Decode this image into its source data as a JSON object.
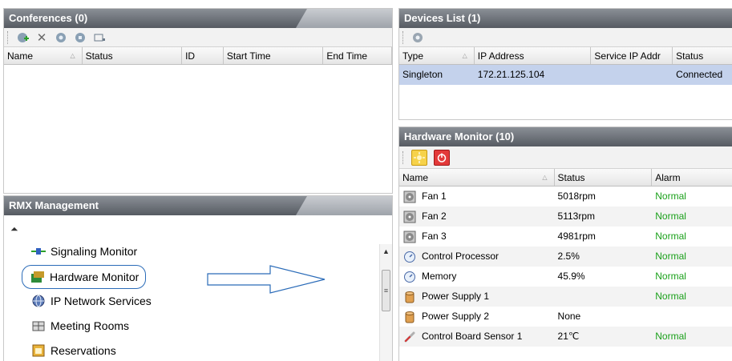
{
  "conferences": {
    "title": "Conferences (0)",
    "columns": [
      "Name",
      "Status",
      "ID",
      "Start Time",
      "End Time"
    ]
  },
  "devices": {
    "title": "Devices List (1)",
    "columns": [
      "Type",
      "IP Address",
      "Service IP Addr",
      "Status"
    ],
    "rows": [
      {
        "type": "Singleton",
        "ip": "172.21.125.104",
        "service_ip": "",
        "status": "Connected"
      }
    ]
  },
  "hardware": {
    "title": "Hardware Monitor (10)",
    "columns": [
      "Name",
      "Status",
      "Alarm"
    ],
    "rows": [
      {
        "name": "Fan 1",
        "status": "5018rpm",
        "alarm": "Normal",
        "icon": "fan-icon"
      },
      {
        "name": "Fan 2",
        "status": "5113rpm",
        "alarm": "Normal",
        "icon": "fan-icon"
      },
      {
        "name": "Fan 3",
        "status": "4981rpm",
        "alarm": "Normal",
        "icon": "fan-icon"
      },
      {
        "name": "Control Processor",
        "status": "2.5%",
        "alarm": "Normal",
        "icon": "gauge-icon"
      },
      {
        "name": "Memory",
        "status": "45.9%",
        "alarm": "Normal",
        "icon": "gauge-icon"
      },
      {
        "name": "Power Supply 1",
        "status": "",
        "alarm": "Normal",
        "icon": "power-supply-icon"
      },
      {
        "name": "Power Supply 2",
        "status": "None",
        "alarm": "",
        "icon": "power-supply-icon"
      },
      {
        "name": "Control Board Sensor 1",
        "status": "21℃",
        "alarm": "Normal",
        "icon": "thermometer-icon"
      }
    ]
  },
  "rmx": {
    "title": "RMX Management",
    "items": [
      {
        "label": "Signaling Monitor",
        "icon": "signaling-icon"
      },
      {
        "label": "Hardware Monitor",
        "icon": "hardware-monitor-icon"
      },
      {
        "label": "IP Network Services",
        "icon": "globe-icon"
      },
      {
        "label": "Meeting Rooms",
        "icon": "meeting-rooms-icon"
      },
      {
        "label": "Reservations",
        "icon": "reservations-icon"
      }
    ]
  },
  "colors": {
    "title_bar": "#565b62",
    "selected_row": "#c4d2ec",
    "normal_text": "#1aa01a",
    "highlight_outline": "#2a6bb8"
  }
}
